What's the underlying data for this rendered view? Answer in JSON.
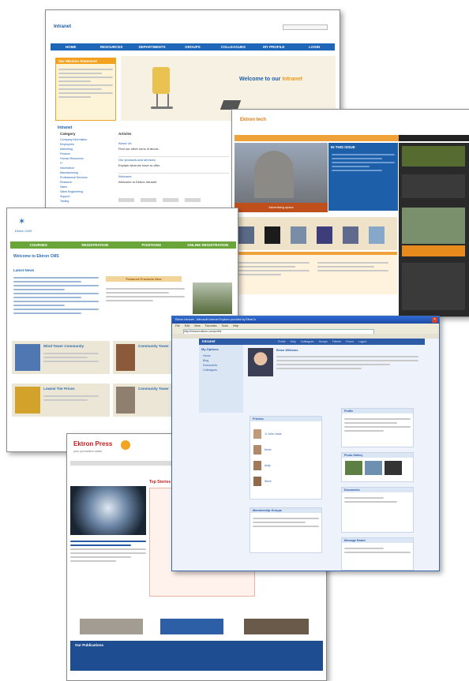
{
  "intranet": {
    "logo": "Intranet",
    "nav": [
      "HOME",
      "RESOURCES",
      "DEPARTMENTS",
      "GROUPS",
      "COLLEAGUES",
      "MY PROFILE",
      "LOGIN"
    ],
    "sidebar_title": "Our Mission Statement",
    "welcome_prefix": "Welcome to our",
    "welcome_word": "Intranet",
    "left_heading": "Intranet",
    "categories_label": "Category",
    "articles_label": "Articles",
    "categories": [
      "Company Information",
      "Employees",
      "Marketing",
      "Finance",
      "Human Resources",
      "IT",
      "Information",
      "Manufacturing",
      "Professional Services",
      "Research",
      "Sales",
      "Sales Engineering",
      "Support",
      "Testing"
    ],
    "articles": [
      "About Us",
      "Find our other sons of about...",
      "Our products and services",
      "Explain what we have to offer",
      "Welcome",
      "Welcome to Ektron Intranet"
    ]
  },
  "ektron_tech": {
    "logo": "Ektron tech",
    "in_this_issue": "IN THIS ISSUE",
    "caption": "Advertising space"
  },
  "ektron_cms": {
    "logo": "Ektron CMS",
    "nav": [
      "COURSES",
      "REGISTRATION",
      "POSITIONS",
      "ONLINE REGISTRATION"
    ],
    "welcome_title": "Welcome to Ektron CMS",
    "latest_news": "Latest News",
    "featured_label": "Featured Products Now",
    "row1_title": "Wind Tower Community",
    "row1b_title": "Community Tower",
    "row2_title": "Lowest Tier Prices",
    "row2b_title": "Community Tower"
  },
  "browser": {
    "title": "Ektron Intranet - Microsoft Internet Explorer provided by ElinsCo",
    "menu": [
      "File",
      "Edit",
      "View",
      "Favorites",
      "Tools",
      "Help"
    ],
    "address": "http://intranet.ektron.com/profile",
    "site_label": "Intranet",
    "tabs": [
      "Profile",
      "Help",
      "Colleagues",
      "Groups",
      "Friends",
      "Forum",
      "Logout"
    ],
    "sidebar_title": "My Options",
    "sidebar_items": [
      "Home",
      "Blog",
      "Documents",
      "Colleagues"
    ],
    "profile_name": "Brian Williams",
    "friends_label": "Friends",
    "friends": [
      "Jr. John Lewis",
      "Kevin",
      "Andy",
      "Steve"
    ],
    "groups_label": "Membership Groups",
    "right_panels": [
      "Profile",
      "Photo Gallery",
      "Documents",
      "Message Board"
    ]
  },
  "press": {
    "logo": "Ektron Press",
    "tagline": "your journalism starts",
    "story_headline": "Top Stories",
    "footer_title": "Our Publications"
  }
}
